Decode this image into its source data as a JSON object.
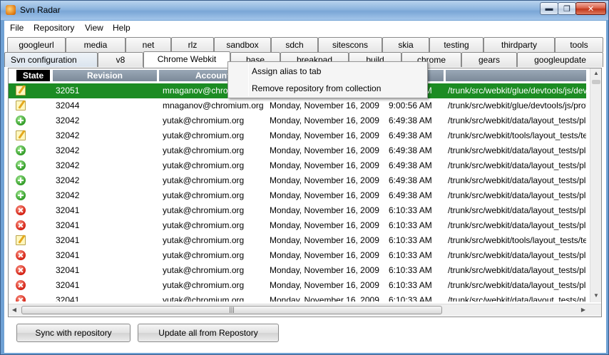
{
  "window": {
    "title": "Svn Radar",
    "min_glyph": "▬",
    "max_glyph": "❐",
    "close_glyph": "✕"
  },
  "menu": [
    "File",
    "Repository",
    "View",
    "Help"
  ],
  "tabs_row1": [
    "googleurl",
    "media",
    "net",
    "rlz",
    "sandbox",
    "sdch",
    "sitescons",
    "skia",
    "testing",
    "thirdparty",
    "tools"
  ],
  "tabs_row2": [
    "Svn configuration",
    "v8",
    "Chrome Webkit",
    "base",
    "breakpad",
    "build",
    "chrome",
    "gears",
    "googleupdate"
  ],
  "selected_tab": "Chrome Webkit",
  "columns": [
    "State",
    "Revision",
    "Account",
    "",
    "",
    ""
  ],
  "rows": [
    {
      "state": "modified",
      "revision": "32051",
      "account": "mnaganov@chromium.org",
      "date": "Monday, November 16, 2009",
      "time": "9:00:56 AM",
      "path": "/trunk/src/webkit/glue/devtools/js/devtools.js"
    },
    {
      "state": "modified",
      "revision": "32044",
      "account": "mnaganov@chromium.org",
      "date": "Monday, November 16, 2009",
      "time": "9:00:56 AM",
      "path": "/trunk/src/webkit/glue/devtools/js/profiler_processor.js"
    },
    {
      "state": "added",
      "revision": "32042",
      "account": "yutak@chromium.org",
      "date": "Monday, November 16, 2009",
      "time": "6:49:38 AM",
      "path": "/trunk/src/webkit/data/layout_tests/platform/chromium"
    },
    {
      "state": "modified",
      "revision": "32042",
      "account": "yutak@chromium.org",
      "date": "Monday, November 16, 2009",
      "time": "6:49:38 AM",
      "path": "/trunk/src/webkit/tools/layout_tests/test_expectations.txt"
    },
    {
      "state": "added",
      "revision": "32042",
      "account": "yutak@chromium.org",
      "date": "Monday, November 16, 2009",
      "time": "6:49:38 AM",
      "path": "/trunk/src/webkit/data/layout_tests/platform/chromium"
    },
    {
      "state": "added",
      "revision": "32042",
      "account": "yutak@chromium.org",
      "date": "Monday, November 16, 2009",
      "time": "6:49:38 AM",
      "path": "/trunk/src/webkit/data/layout_tests/platform/chromium"
    },
    {
      "state": "added",
      "revision": "32042",
      "account": "yutak@chromium.org",
      "date": "Monday, November 16, 2009",
      "time": "6:49:38 AM",
      "path": "/trunk/src/webkit/data/layout_tests/platform/chromium"
    },
    {
      "state": "added",
      "revision": "32042",
      "account": "yutak@chromium.org",
      "date": "Monday, November 16, 2009",
      "time": "6:49:38 AM",
      "path": "/trunk/src/webkit/data/layout_tests/platform/chromium"
    },
    {
      "state": "deleted",
      "revision": "32041",
      "account": "yutak@chromium.org",
      "date": "Monday, November 16, 2009",
      "time": "6:10:33 AM",
      "path": "/trunk/src/webkit/data/layout_tests/platform/chromium"
    },
    {
      "state": "deleted",
      "revision": "32041",
      "account": "yutak@chromium.org",
      "date": "Monday, November 16, 2009",
      "time": "6:10:33 AM",
      "path": "/trunk/src/webkit/data/layout_tests/platform/chromium"
    },
    {
      "state": "modified",
      "revision": "32041",
      "account": "yutak@chromium.org",
      "date": "Monday, November 16, 2009",
      "time": "6:10:33 AM",
      "path": "/trunk/src/webkit/tools/layout_tests/test_expectations.txt"
    },
    {
      "state": "deleted",
      "revision": "32041",
      "account": "yutak@chromium.org",
      "date": "Monday, November 16, 2009",
      "time": "6:10:33 AM",
      "path": "/trunk/src/webkit/data/layout_tests/platform/chromium"
    },
    {
      "state": "deleted",
      "revision": "32041",
      "account": "yutak@chromium.org",
      "date": "Monday, November 16, 2009",
      "time": "6:10:33 AM",
      "path": "/trunk/src/webkit/data/layout_tests/platform/chromium"
    },
    {
      "state": "deleted",
      "revision": "32041",
      "account": "yutak@chromium.org",
      "date": "Monday, November 16, 2009",
      "time": "6:10:33 AM",
      "path": "/trunk/src/webkit/data/layout_tests/platform/chromium"
    },
    {
      "state": "deleted",
      "revision": "32041",
      "account": "yutak@chromium.org",
      "date": "Monday, November 16, 2009",
      "time": "6:10:33 AM",
      "path": "/trunk/src/webkit/data/layout_tests/platform/chromium"
    }
  ],
  "context_menu": [
    "Assign alias to tab",
    "Remove repository from collection"
  ],
  "buttons": {
    "sync": "Sync with repository",
    "update_all": "Update all from Repostory"
  },
  "scroll": {
    "up": "▲",
    "down": "▼",
    "left": "◀",
    "right": "▶",
    "grip": "|||"
  },
  "colors": {
    "selected_row": "#1c8c23",
    "title_bar": "#8cb4de",
    "header": "#7b8999"
  }
}
